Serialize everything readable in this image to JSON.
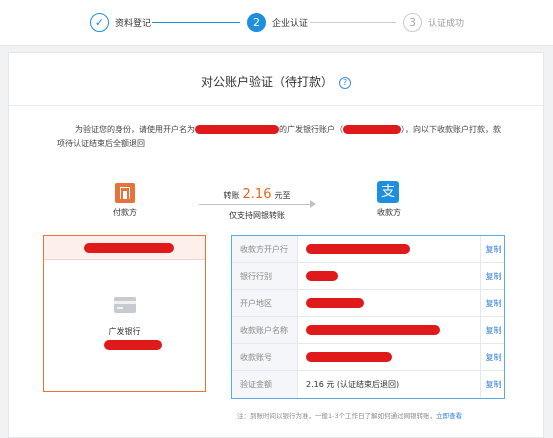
{
  "steps": [
    {
      "num": "✓",
      "label": "资料登记",
      "state": "done"
    },
    {
      "num": "2",
      "label": "企业认证",
      "state": "active"
    },
    {
      "num": "3",
      "label": "认证成功",
      "state": "todo"
    }
  ],
  "title": "对公账户验证（待打款）",
  "help_glyph": "?",
  "notice": {
    "part1": "为验证您的身份，请使用开户名为",
    "part2": "的广发银行账户（",
    "part3": "），向以下收款账户打款，款",
    "part4": "项待认证结束后全额退回"
  },
  "transfer": {
    "prefix": "转账",
    "amount": "2.16",
    "suffix": "元至",
    "only_online": "仅支持网银转账",
    "payer_label": "付款方",
    "payee_label": "收款方",
    "alipay_glyph": "支"
  },
  "payer_box": {
    "bank_name": "广发银行"
  },
  "table": {
    "copy_label": "复制",
    "rows": [
      {
        "label": "收款方开户行",
        "value": ""
      },
      {
        "label": "银行行别",
        "value": ""
      },
      {
        "label": "开户地区",
        "value": ""
      },
      {
        "label": "收款账户名称",
        "value": ""
      },
      {
        "label": "收款账号",
        "value": ""
      },
      {
        "label": "验证金额",
        "value": "2.16 元 (认证结束后退回)"
      }
    ]
  },
  "footnote": {
    "text": "注：到账时间以银行为准，一般1-3个工作日了解如何通过网银转账，",
    "link": "立即查看"
  },
  "colors": {
    "accent": "#1e8fde",
    "orange": "#e8733a",
    "redaction": "#e01a1a"
  }
}
